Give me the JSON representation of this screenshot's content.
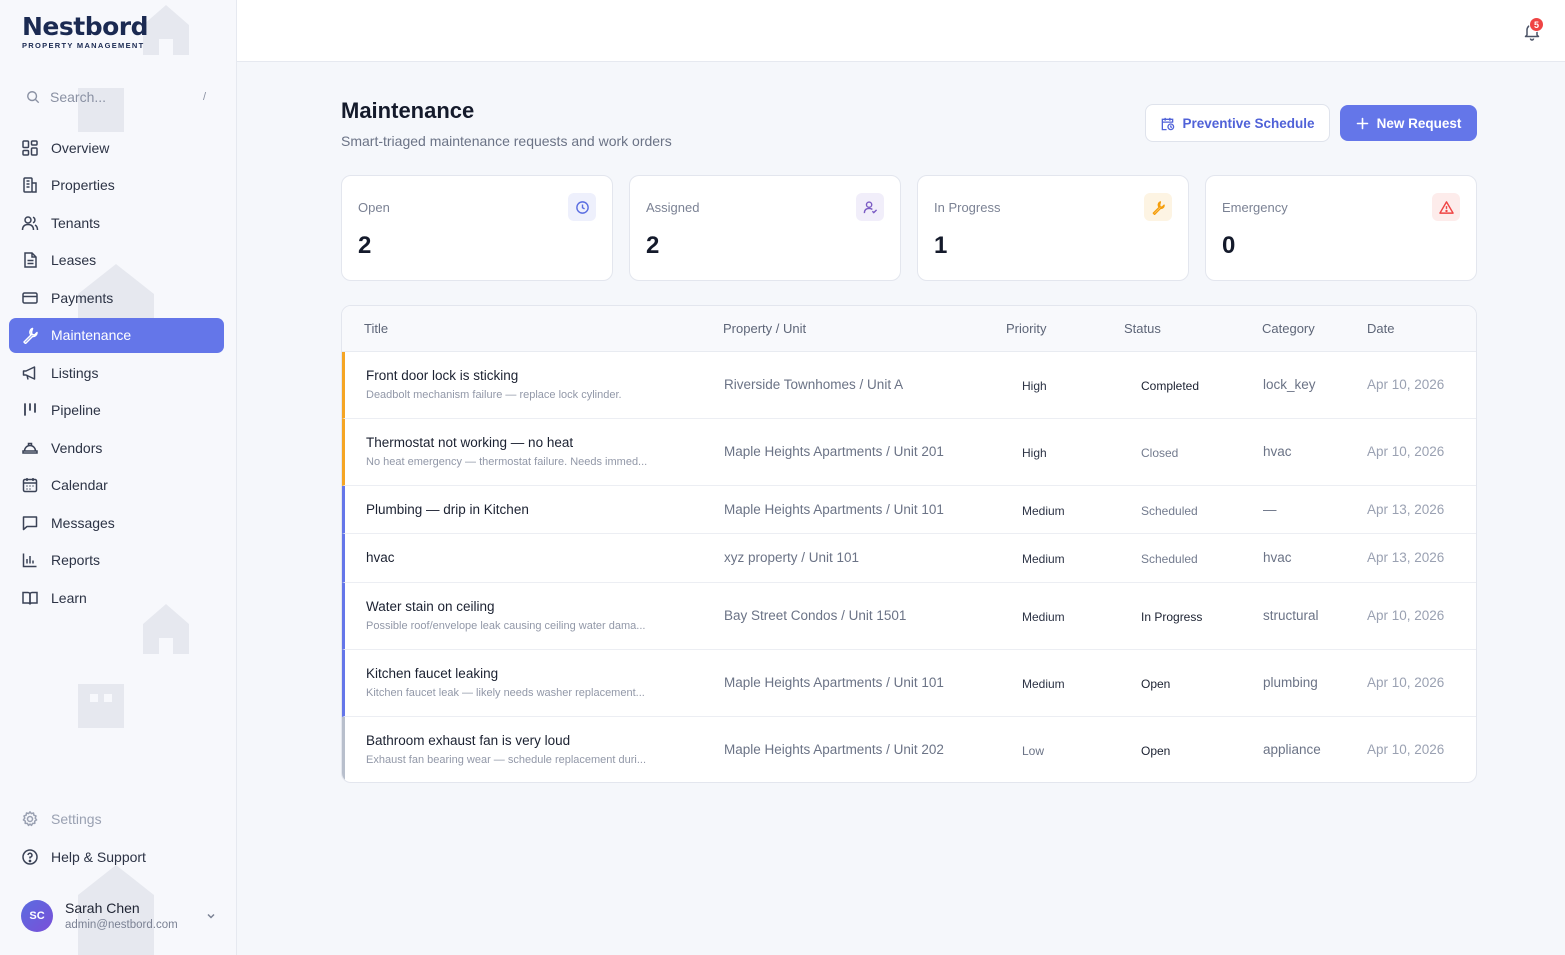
{
  "brand": {
    "name": "Nestbord",
    "tagline": "PROPERTY MANAGEMENT"
  },
  "search": {
    "placeholder": "Search...",
    "shortcut": "/"
  },
  "sidebar": {
    "items": [
      {
        "label": "Overview",
        "icon": "grid-icon",
        "active": false
      },
      {
        "label": "Properties",
        "icon": "building-icon",
        "active": false
      },
      {
        "label": "Tenants",
        "icon": "users-icon",
        "active": false
      },
      {
        "label": "Leases",
        "icon": "document-icon",
        "active": false
      },
      {
        "label": "Payments",
        "icon": "credit-card-icon",
        "active": false
      },
      {
        "label": "Maintenance",
        "icon": "wrench-icon",
        "active": true
      },
      {
        "label": "Listings",
        "icon": "megaphone-icon",
        "active": false
      },
      {
        "label": "Pipeline",
        "icon": "kanban-icon",
        "active": false
      },
      {
        "label": "Vendors",
        "icon": "hard-hat-icon",
        "active": false
      },
      {
        "label": "Calendar",
        "icon": "calendar-icon",
        "active": false
      },
      {
        "label": "Messages",
        "icon": "message-icon",
        "active": false
      },
      {
        "label": "Reports",
        "icon": "bar-chart-icon",
        "active": false
      },
      {
        "label": "Learn",
        "icon": "book-icon",
        "active": false
      }
    ],
    "bottom": [
      {
        "label": "Settings",
        "icon": "gear-icon"
      },
      {
        "label": "Help & Support",
        "icon": "help-circle-icon"
      }
    ]
  },
  "user": {
    "initials": "SC",
    "name": "Sarah Chen",
    "email": "admin@nestbord.com"
  },
  "notifications": {
    "count": "5"
  },
  "page": {
    "title": "Maintenance",
    "subtitle": "Smart-triaged maintenance requests and work orders",
    "preventive_button": "Preventive Schedule",
    "new_button": "New Request"
  },
  "stats": [
    {
      "label": "Open",
      "value": "2",
      "icon": "clock-icon",
      "color": "#5b6ee1"
    },
    {
      "label": "Assigned",
      "value": "2",
      "icon": "user-check-icon",
      "color": "#7b5cc4"
    },
    {
      "label": "In Progress",
      "value": "1",
      "icon": "wrench-icon",
      "color": "#f59e0b"
    },
    {
      "label": "Emergency",
      "value": "0",
      "icon": "alert-triangle-icon",
      "color": "#ef4444"
    }
  ],
  "table": {
    "columns": [
      "Title",
      "Property / Unit",
      "Priority",
      "Status",
      "Category",
      "Date"
    ],
    "rows": [
      {
        "title": "Front door lock is sticking",
        "desc": "Deadbolt mechanism failure — replace lock cylinder.",
        "property": "Riverside Townhomes / Unit A",
        "priority": "High",
        "status": "Completed",
        "category": "lock_key",
        "date": "Apr 10, 2026",
        "accent": "#f5a524"
      },
      {
        "title": "Thermostat not working — no heat",
        "desc": "No heat emergency — thermostat failure. Needs immed...",
        "property": "Maple Heights Apartments / Unit 201",
        "priority": "High",
        "status": "Closed",
        "category": "hvac",
        "date": "Apr 10, 2026",
        "accent": "#f5a524"
      },
      {
        "title": "Plumbing — drip in Kitchen",
        "desc": "",
        "property": "Maple Heights Apartments / Unit 101",
        "priority": "Medium",
        "status": "Scheduled",
        "category": "—",
        "date": "Apr 13, 2026",
        "accent": "#6476e9"
      },
      {
        "title": "hvac",
        "desc": "",
        "property": "xyz property / Unit 101",
        "priority": "Medium",
        "status": "Scheduled",
        "category": "hvac",
        "date": "Apr 13, 2026",
        "accent": "#6476e9"
      },
      {
        "title": "Water stain on ceiling",
        "desc": "Possible roof/envelope leak causing ceiling water dama...",
        "property": "Bay Street Condos / Unit 1501",
        "priority": "Medium",
        "status": "In Progress",
        "category": "structural",
        "date": "Apr 10, 2026",
        "accent": "#6476e9"
      },
      {
        "title": "Kitchen faucet leaking",
        "desc": "Kitchen faucet leak — likely needs washer replacement...",
        "property": "Maple Heights Apartments / Unit 101",
        "priority": "Medium",
        "status": "Open",
        "category": "plumbing",
        "date": "Apr 10, 2026",
        "accent": "#6476e9"
      },
      {
        "title": "Bathroom exhaust fan is very loud",
        "desc": "Exhaust fan bearing wear — schedule replacement duri...",
        "property": "Maple Heights Apartments / Unit 202",
        "priority": "Low",
        "status": "Open",
        "category": "appliance",
        "date": "Apr 10, 2026",
        "accent": "#b8bfcc"
      }
    ]
  },
  "colors": {
    "accent": "#6476e9",
    "sidebar_bg": "#f7f8fc",
    "page_bg": "#f5f7fb"
  }
}
